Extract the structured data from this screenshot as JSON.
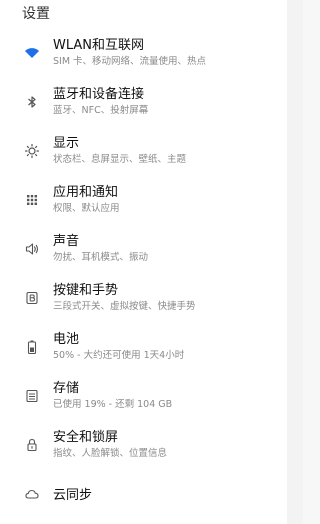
{
  "header": {
    "title": "设置"
  },
  "colors": {
    "accent": "#1f6fe6",
    "icon_gray": "#555555",
    "title_text": "#111111",
    "subtitle_text": "#8a8a8a"
  },
  "items": [
    {
      "title": "WLAN和互联网",
      "subtitle": "SIM 卡、移动网络、流量使用、热点",
      "icon": "wifi-icon"
    },
    {
      "title": "蓝牙和设备连接",
      "subtitle": "蓝牙、NFC、投射屏幕",
      "icon": "bluetooth-icon"
    },
    {
      "title": "显示",
      "subtitle": "状态栏、息屏显示、壁纸、主题",
      "icon": "brightness-icon"
    },
    {
      "title": "应用和通知",
      "subtitle": "权限、默认应用",
      "icon": "apps-grid-icon"
    },
    {
      "title": "声音",
      "subtitle": "勿扰、耳机模式、振动",
      "icon": "volume-icon"
    },
    {
      "title": "按键和手势",
      "subtitle": "三段式开关、虚拟按键、快捷手势",
      "icon": "buttons-icon"
    },
    {
      "title": "电池",
      "subtitle": "50% - 大约还可使用 1天4小时",
      "icon": "battery-icon"
    },
    {
      "title": "存储",
      "subtitle": "已使用 19% - 还剩 104 GB",
      "icon": "storage-icon"
    },
    {
      "title": "安全和锁屏",
      "subtitle": "指纹、人脸解锁、位置信息",
      "icon": "lock-icon"
    },
    {
      "title": "云同步",
      "icon": "cloud-icon"
    }
  ]
}
